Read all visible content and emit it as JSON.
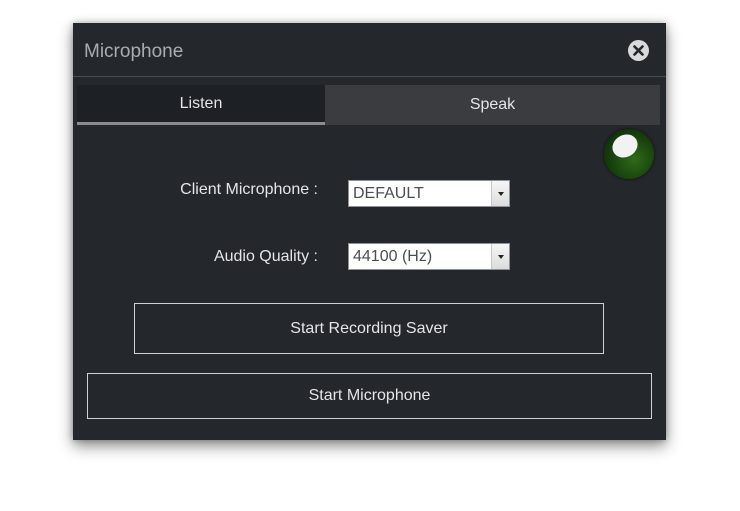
{
  "dialog": {
    "title": "Microphone",
    "close_icon": "close-circle-icon"
  },
  "tabs": [
    {
      "label": "Listen",
      "active": true
    },
    {
      "label": "Speak",
      "active": false
    }
  ],
  "status_indicator": {
    "icon": "microphone-status-led",
    "color": "#1f4f10"
  },
  "form": {
    "client_microphone": {
      "label": "Client Microphone :",
      "value": "DEFAULT"
    },
    "audio_quality": {
      "label": "Audio Quality :",
      "value": "44100 (Hz)"
    }
  },
  "buttons": {
    "start_recording_saver": "Start Recording Saver",
    "start_microphone": "Start Microphone"
  },
  "colors": {
    "panel_background": "#24272c",
    "tab_active": "#1d2025",
    "tab_inactive": "#3a3c40",
    "text": "#e4e5e7"
  }
}
